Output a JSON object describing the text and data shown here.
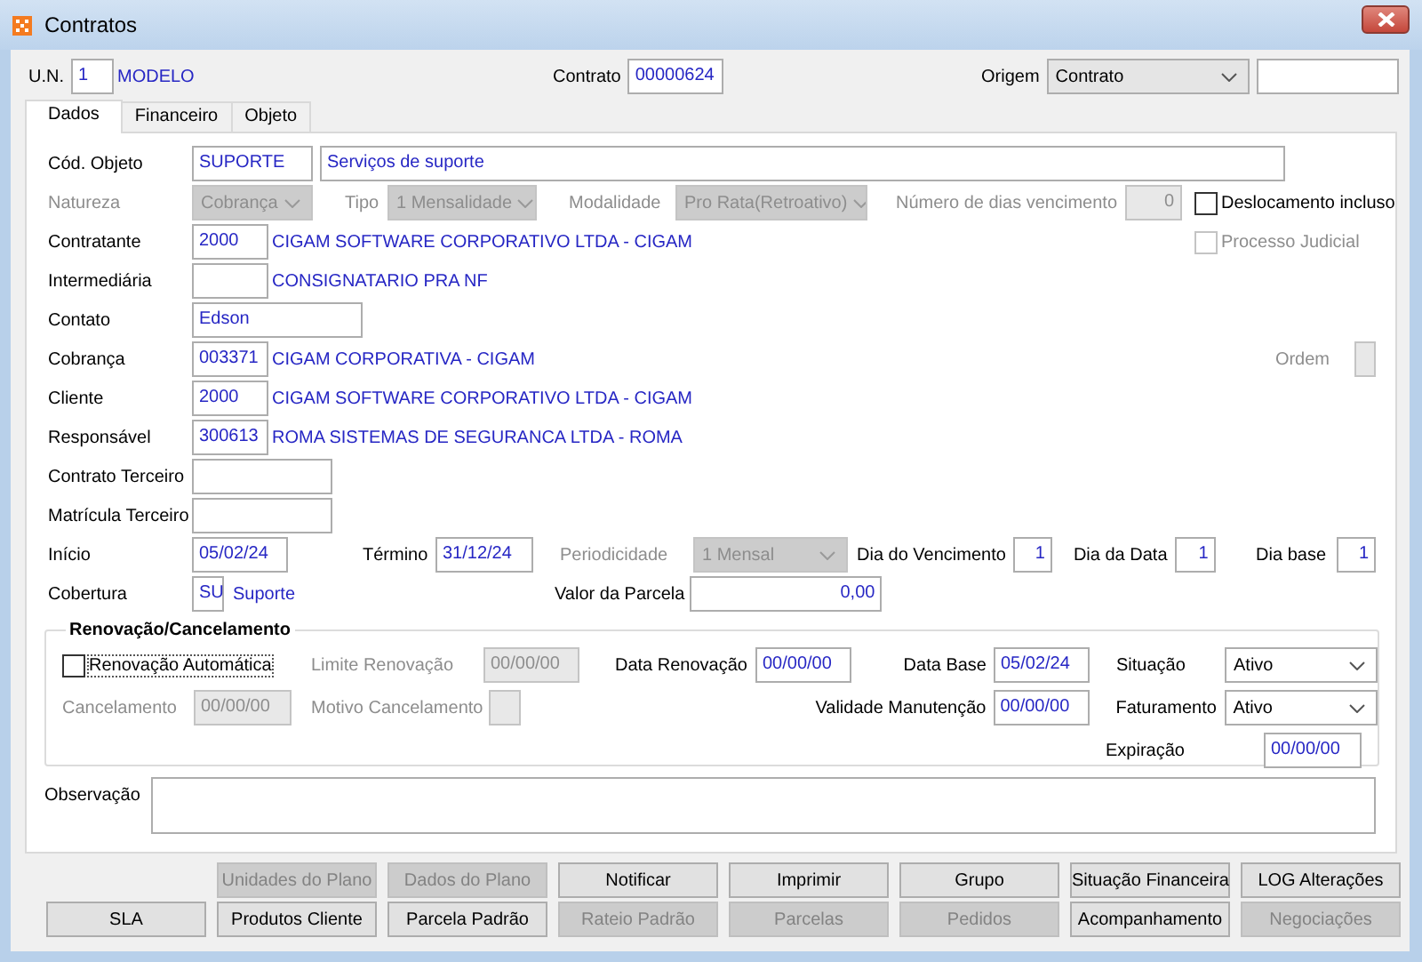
{
  "window": {
    "title": "Contratos"
  },
  "header": {
    "un": {
      "label": "U.N.",
      "value": "1",
      "name": "MODELO"
    },
    "contrato": {
      "label": "Contrato",
      "value": "00000624"
    },
    "origem": {
      "label": "Origem",
      "value": "Contrato"
    }
  },
  "tabs": [
    {
      "label": "Dados",
      "selected": true
    },
    {
      "label": "Financeiro",
      "selected": false
    },
    {
      "label": "Objeto",
      "selected": false
    }
  ],
  "dados": {
    "cod_objeto": {
      "label": "Cód. Objeto",
      "value": "SUPORTE",
      "description": "Serviços de suporte"
    },
    "natureza": {
      "label": "Natureza",
      "value": "Cobrança",
      "disabled": true
    },
    "tipo": {
      "label": "Tipo",
      "value": "1 Mensalidade",
      "disabled": true
    },
    "modalidade": {
      "label": "Modalidade",
      "value": "Pro Rata(Retroativo)",
      "disabled": true
    },
    "dias_vencimento": {
      "label": "Número de dias vencimento",
      "value": "0",
      "disabled": true
    },
    "deslocamento": {
      "label": "Deslocamento incluso",
      "checked": false
    },
    "contratante": {
      "label": "Contratante",
      "value": "2000",
      "name": "CIGAM SOFTWARE CORPORATIVO LTDA - CIGAM"
    },
    "processo_judicial": {
      "label": "Processo Judicial",
      "checked": false,
      "disabled": true
    },
    "intermediaria": {
      "label": "Intermediária",
      "name": "CONSIGNATARIO PRA NF"
    },
    "contato": {
      "label": "Contato",
      "value": "Edson"
    },
    "cobranca": {
      "label": "Cobrança",
      "value": "003371",
      "name": "CIGAM CORPORATIVA - CIGAM"
    },
    "ordem": {
      "label": "Ordem",
      "disabled": true
    },
    "cliente": {
      "label": "Cliente",
      "value": "2000",
      "name": "CIGAM SOFTWARE CORPORATIVO LTDA - CIGAM"
    },
    "responsavel": {
      "label": "Responsável",
      "value": "300613",
      "name": "ROMA SISTEMAS DE SEGURANCA LTDA - ROMA"
    },
    "contrato_terceiro": {
      "label": "Contrato Terceiro"
    },
    "matricula_terceiro": {
      "label": "Matrícula Terceiro"
    },
    "inicio": {
      "label": "Início",
      "value": "05/02/24"
    },
    "termino": {
      "label": "Término",
      "value": "31/12/24"
    },
    "periodicidade": {
      "label": "Periodicidade",
      "value": "1 Mensal",
      "disabled": true
    },
    "dia_vencimento": {
      "label": "Dia do Vencimento",
      "value": "1"
    },
    "dia_data": {
      "label": "Dia da Data",
      "value": "1"
    },
    "dia_base": {
      "label": "Dia base",
      "value": "1"
    },
    "cobertura": {
      "label": "Cobertura",
      "value": "SU",
      "name": "Suporte"
    },
    "valor_parcela": {
      "label": "Valor da Parcela",
      "value": "0,00"
    }
  },
  "renovacao": {
    "title": "Renovação/Cancelamento",
    "automatica": {
      "label": "Renovação Automática",
      "checked": false
    },
    "limite": {
      "label": "Limite Renovação",
      "value": "00/00/00",
      "disabled": true
    },
    "data_renovacao": {
      "label": "Data Renovação",
      "value": "00/00/00"
    },
    "data_base": {
      "label": "Data Base",
      "value": "05/02/24"
    },
    "situacao": {
      "label": "Situação",
      "value": "Ativo"
    },
    "cancelamento": {
      "label": "Cancelamento",
      "value": "00/00/00",
      "disabled": true
    },
    "motivo": {
      "label": "Motivo Cancelamento",
      "disabled": true
    },
    "validade": {
      "label": "Validade Manutenção",
      "value": "00/00/00"
    },
    "faturamento": {
      "label": "Faturamento",
      "value": "Ativo"
    },
    "expiracao": {
      "label": "Expiração",
      "value": "00/00/00"
    }
  },
  "observacao": {
    "label": "Observação"
  },
  "buttons_top": [
    {
      "label": "Unidades do Plano",
      "disabled": true
    },
    {
      "label": "Dados do Plano",
      "disabled": true
    },
    {
      "label": "Notificar",
      "disabled": false
    },
    {
      "label": "Imprimir",
      "disabled": false
    },
    {
      "label": "Grupo",
      "disabled": false
    },
    {
      "label": "Situação Financeira",
      "disabled": false
    },
    {
      "label": "LOG Alterações",
      "disabled": false
    }
  ],
  "buttons_bottom": [
    {
      "label": "SLA",
      "disabled": false
    },
    {
      "label": "Produtos Cliente",
      "disabled": false
    },
    {
      "label": "Parcela Padrão",
      "disabled": false
    },
    {
      "label": "Rateio Padrão",
      "disabled": true
    },
    {
      "label": "Parcelas",
      "disabled": true
    },
    {
      "label": "Pedidos",
      "disabled": true
    },
    {
      "label": "Acompanhamento",
      "disabled": false
    },
    {
      "label": "Negociações",
      "disabled": true
    }
  ]
}
